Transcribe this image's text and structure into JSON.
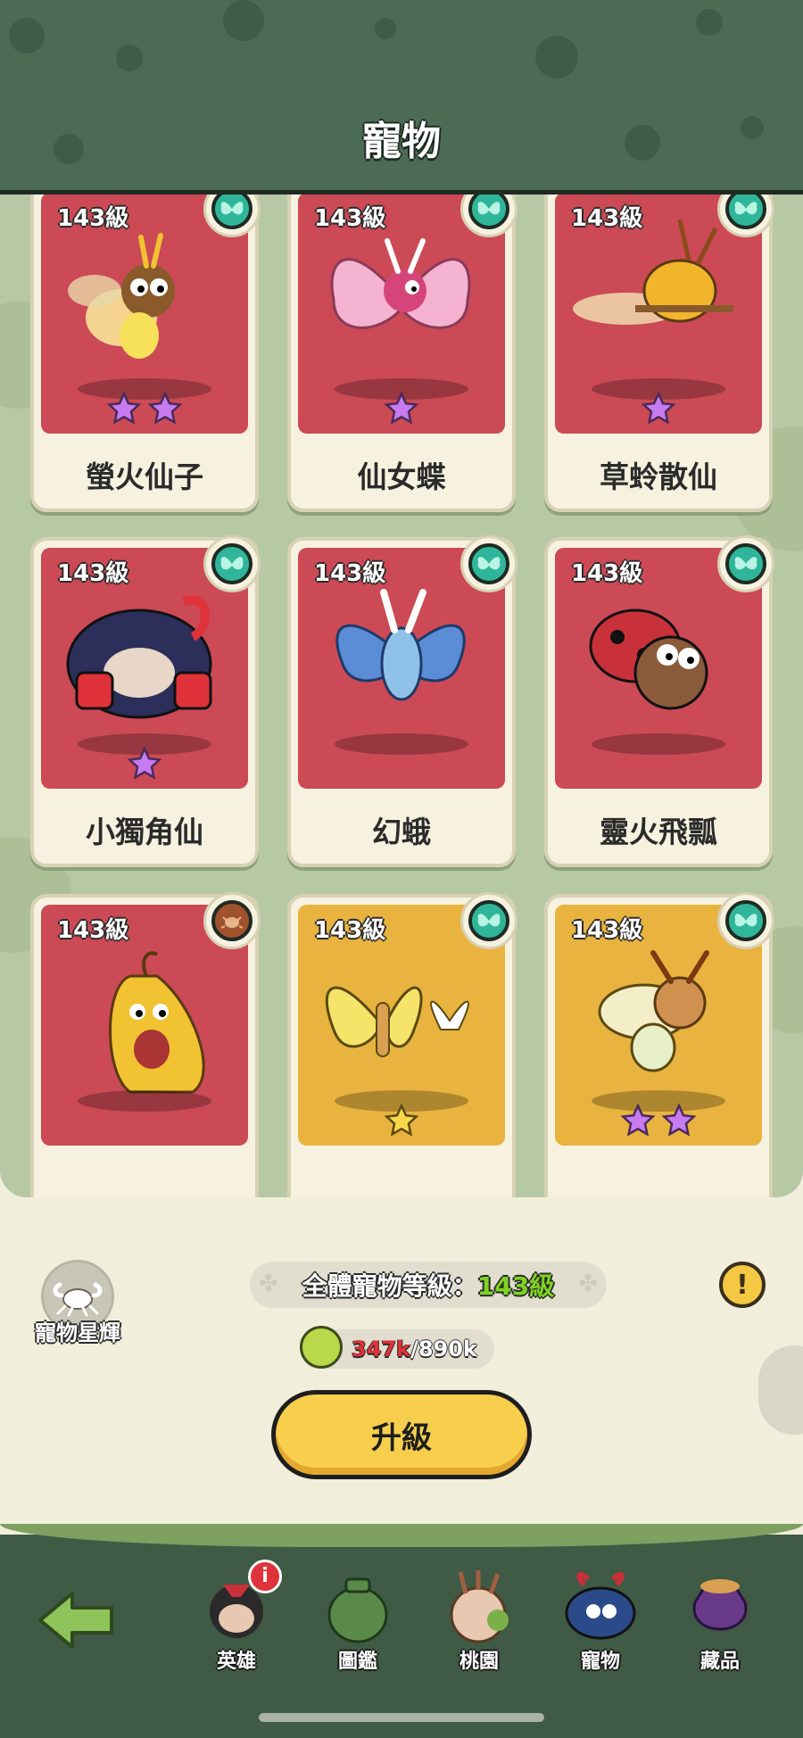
{
  "header": {
    "title": "寵物"
  },
  "cards": [
    {
      "level": "143級",
      "name": "螢火仙子",
      "stars": 2,
      "bg": "#cb4a55",
      "type_icon": "butterfly-type-icon",
      "type_color": "#2fb69a"
    },
    {
      "level": "143級",
      "name": "仙女蝶",
      "stars": 1,
      "bg": "#cb4a55",
      "type_icon": "butterfly-type-icon",
      "type_color": "#2fb69a"
    },
    {
      "level": "143級",
      "name": "草蛉散仙",
      "stars": 1,
      "bg": "#cb4a55",
      "type_icon": "butterfly-type-icon",
      "type_color": "#2fb69a"
    },
    {
      "level": "143級",
      "name": "小獨角仙",
      "stars": 1,
      "bg": "#cb4a55",
      "type_icon": "butterfly-type-icon",
      "type_color": "#2fb69a"
    },
    {
      "level": "143級",
      "name": "幻蛾",
      "stars": 0,
      "bg": "#cb4a55",
      "type_icon": "butterfly-type-icon",
      "type_color": "#2fb69a"
    },
    {
      "level": "143級",
      "name": "靈火飛瓢",
      "stars": 0,
      "bg": "#cb4a55",
      "type_icon": "butterfly-type-icon",
      "type_color": "#2fb69a"
    },
    {
      "level": "143級",
      "name": "",
      "stars": 0,
      "bg": "#cb4a55",
      "type_icon": "crab-type-icon",
      "type_color": "#a0522d"
    },
    {
      "level": "143級",
      "name": "",
      "stars": 1,
      "bg": "#e9b33f",
      "type_icon": "butterfly-type-icon",
      "type_color": "#2fb69a"
    },
    {
      "level": "143級",
      "name": "",
      "stars": 2,
      "bg": "#e9b33f",
      "type_icon": "butterfly-type-icon",
      "type_color": "#2fb69a"
    }
  ],
  "star_glow": {
    "label": "寵物星輝",
    "icon": "crab-icon"
  },
  "total_level": {
    "label": "全體寵物等級：",
    "value": "143級"
  },
  "cost": {
    "current": "347k",
    "max": "/890k",
    "icon": "fruit-slice-icon"
  },
  "upgrade_button": {
    "label": "升級"
  },
  "info_button": {
    "label": "!"
  },
  "nav": {
    "items": [
      {
        "label": "",
        "icon": "back-arrow-icon"
      },
      {
        "label": "英雄",
        "icon": "hero-avatar-icon",
        "alert": "i"
      },
      {
        "label": "圖鑑",
        "icon": "codex-jar-icon"
      },
      {
        "label": "桃園",
        "icon": "peach-garden-icon"
      },
      {
        "label": "寵物",
        "icon": "pet-beetle-icon"
      },
      {
        "label": "藏品",
        "icon": "treasure-bag-icon"
      }
    ]
  },
  "colors": {
    "header": "#4c6b55",
    "grid_bg": "#b7c8a4",
    "accent_green": "#7ed321",
    "cost_red": "#e0323a",
    "button_yellow": "#f7cf4d"
  }
}
